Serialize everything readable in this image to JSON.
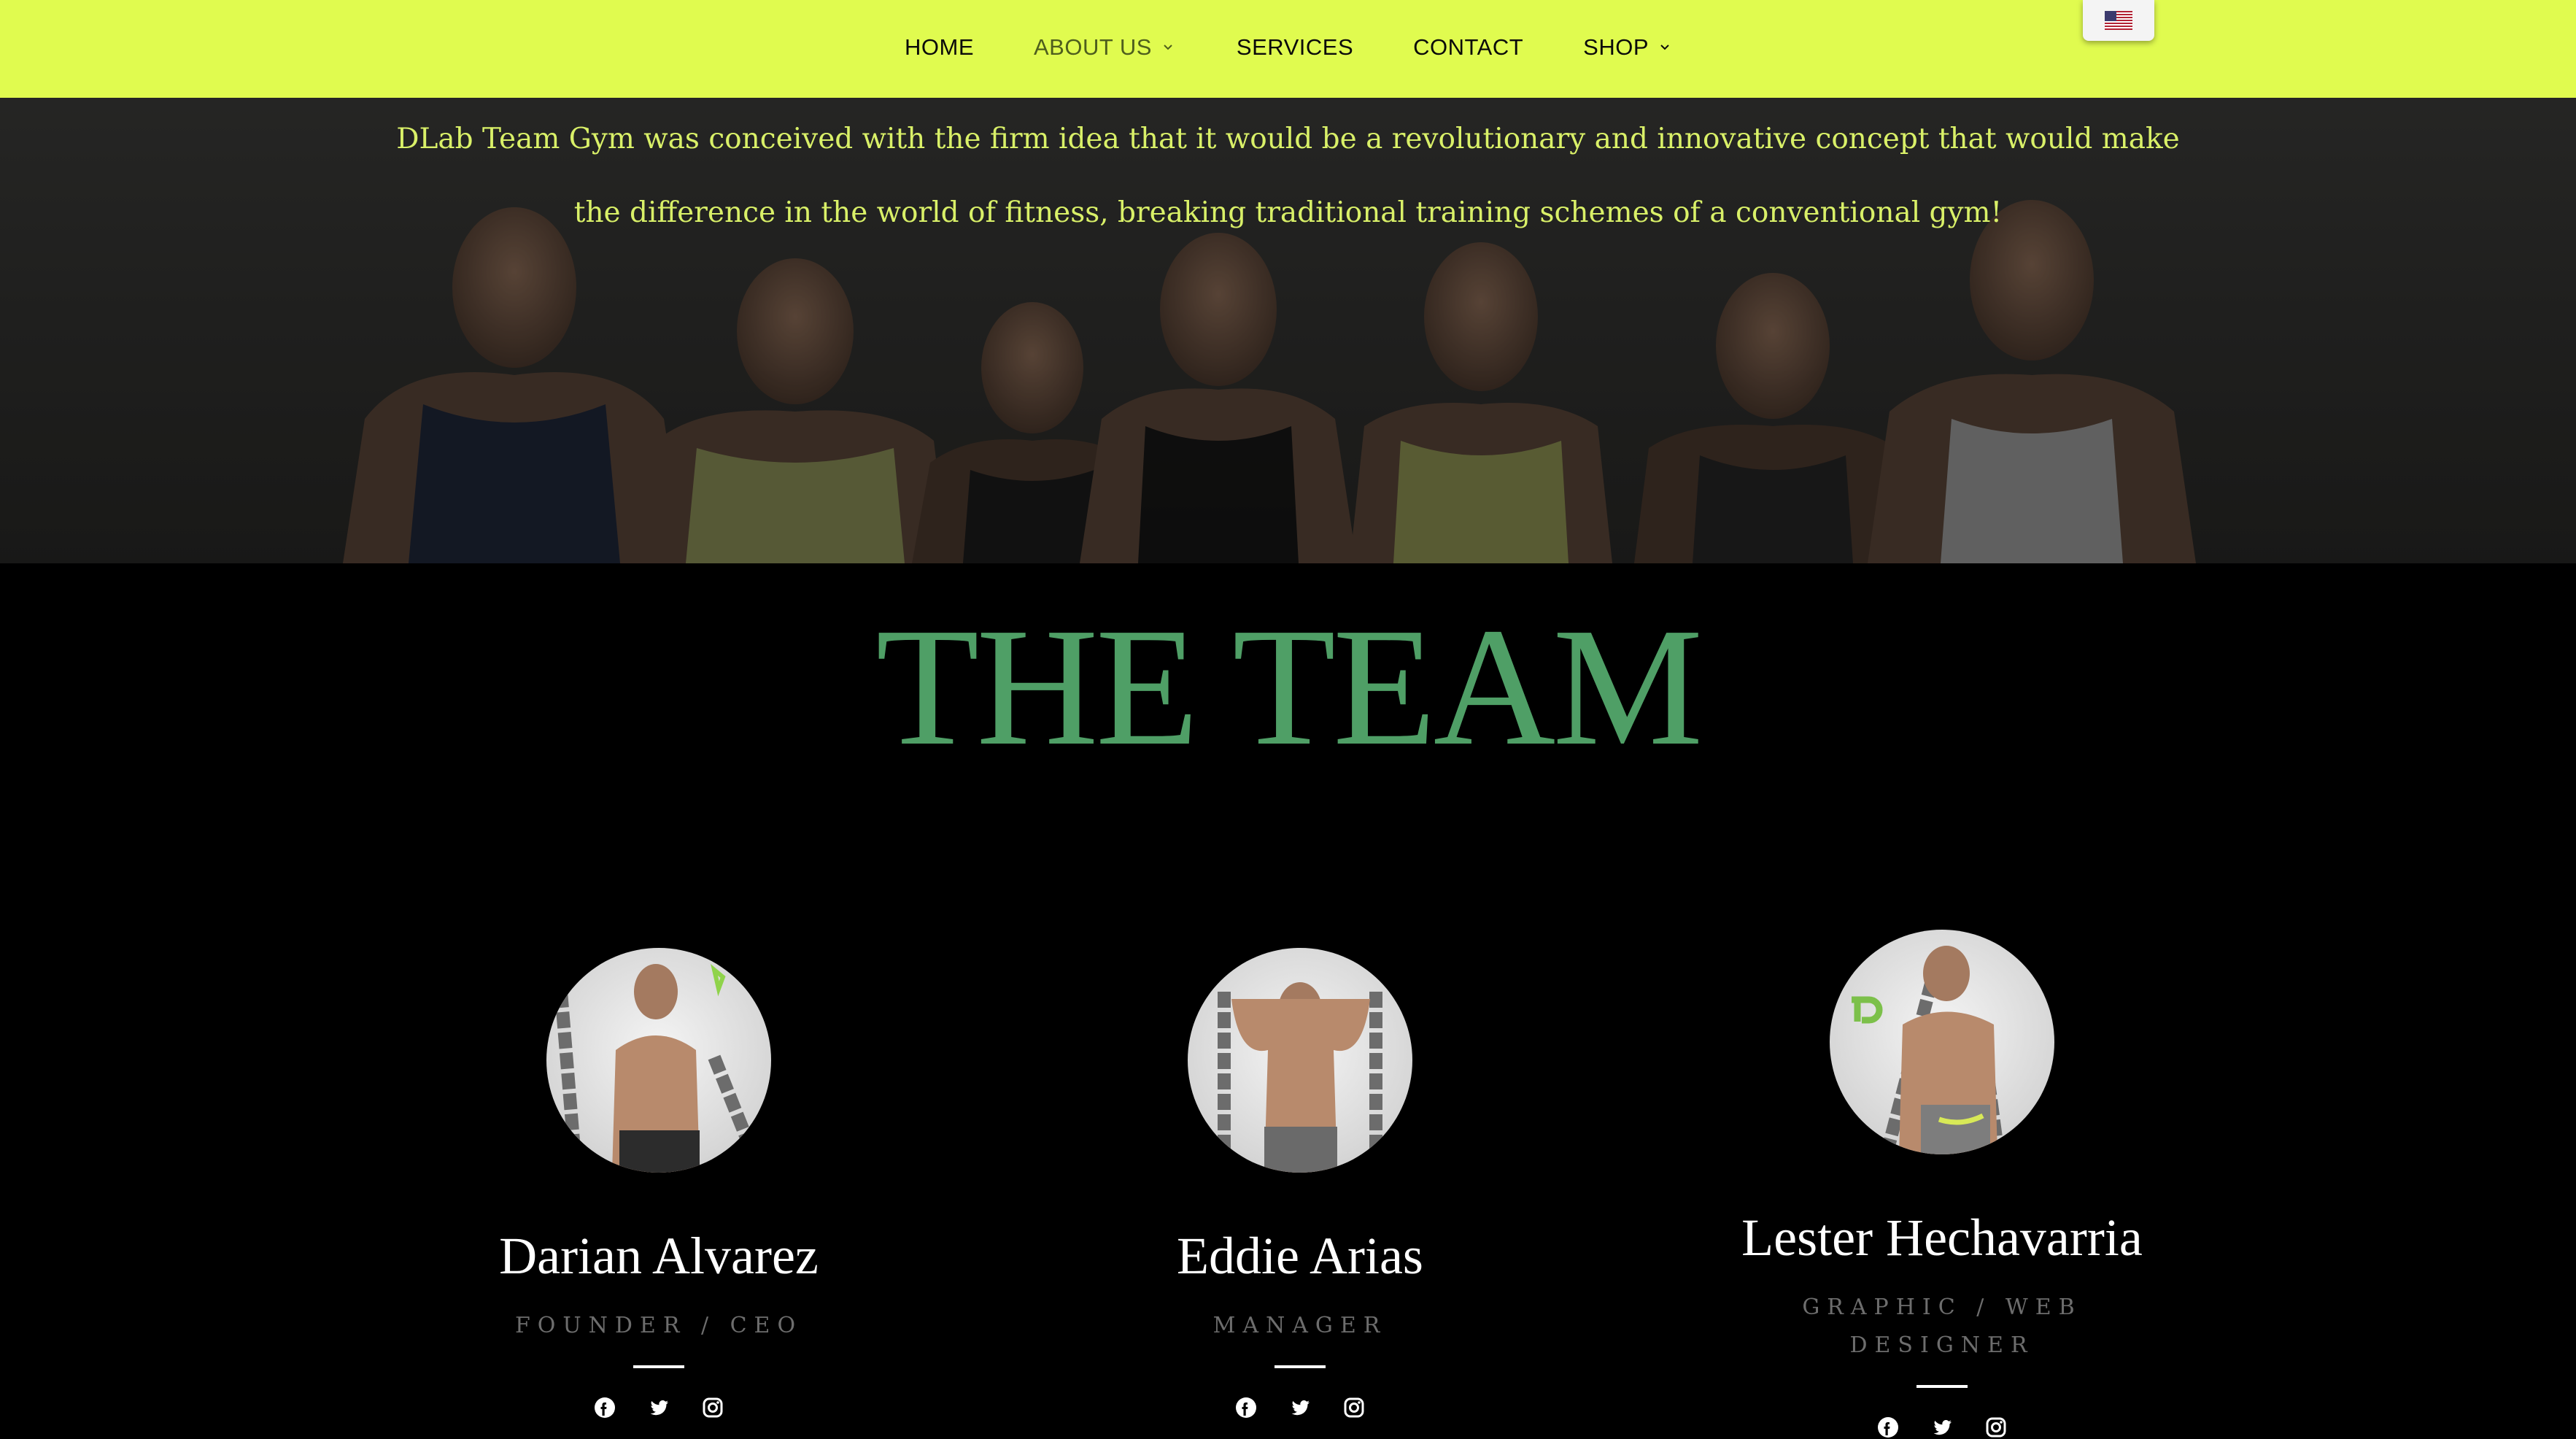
{
  "nav": {
    "items": [
      {
        "label": "HOME",
        "dropdown": false,
        "active": false
      },
      {
        "label": "ABOUT US",
        "dropdown": true,
        "active": true
      },
      {
        "label": "SERVICES",
        "dropdown": false,
        "active": false
      },
      {
        "label": "CONTACT",
        "dropdown": false,
        "active": false
      },
      {
        "label": "SHOP",
        "dropdown": true,
        "active": false
      }
    ],
    "language_icon": "us-flag-icon"
  },
  "hero": {
    "line1": "DLab Team Gym was conceived with the firm idea that it would be a revolutionary and innovative concept that would make",
    "line2": "the difference in the world of fitness, breaking traditional training schemes of a conventional gym!"
  },
  "team": {
    "title": "THE TEAM",
    "members": [
      {
        "name": "Darian Alvarez",
        "role": "FOUNDER / CEO",
        "social_icons": [
          "facebook-icon",
          "twitter-icon",
          "instagram-icon"
        ]
      },
      {
        "name": "Eddie Arias",
        "role": "MANAGER",
        "social_icons": [
          "facebook-icon",
          "twitter-icon",
          "instagram-icon"
        ]
      },
      {
        "name": "Lester Hechavarria",
        "role": "GRAPHIC / WEB DESIGNER",
        "social_icons": [
          "facebook-icon",
          "twitter-icon",
          "instagram-icon"
        ]
      }
    ]
  },
  "colors": {
    "nav_bg": "#e0fb4f",
    "hero_text": "#d9f068",
    "title_green": "#4f9f66",
    "page_bg": "#000000"
  }
}
